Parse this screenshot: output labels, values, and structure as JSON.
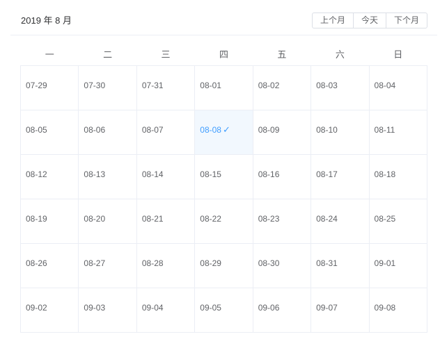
{
  "header": {
    "title": "2019 年 8 月",
    "prev_label": "上个月",
    "today_label": "今天",
    "next_label": "下个月"
  },
  "weekdays": [
    "一",
    "二",
    "三",
    "四",
    "五",
    "六",
    "日"
  ],
  "weeks": [
    [
      "07-29",
      "07-30",
      "07-31",
      "08-01",
      "08-02",
      "08-03",
      "08-04"
    ],
    [
      "08-05",
      "08-06",
      "08-07",
      "08-08",
      "08-09",
      "08-10",
      "08-11"
    ],
    [
      "08-12",
      "08-13",
      "08-14",
      "08-15",
      "08-16",
      "08-17",
      "08-18"
    ],
    [
      "08-19",
      "08-20",
      "08-21",
      "08-22",
      "08-23",
      "08-24",
      "08-25"
    ],
    [
      "08-26",
      "08-27",
      "08-28",
      "08-29",
      "08-30",
      "08-31",
      "09-01"
    ],
    [
      "09-02",
      "09-03",
      "09-04",
      "09-05",
      "09-06",
      "09-07",
      "09-08"
    ]
  ],
  "selected_date": "08-08",
  "selected_mark": "✓",
  "colors": {
    "accent": "#409eff",
    "selected_bg": "#f2f8fe",
    "border": "#ebeef5",
    "text": "#606266"
  }
}
